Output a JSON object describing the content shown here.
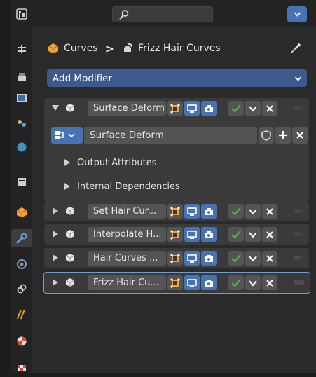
{
  "header": {
    "editor_type_icon": "properties-editor-icon",
    "search_placeholder": "",
    "dropdown_icon": "chevron-down-icon"
  },
  "breadcrumb": {
    "object_name": "Curves",
    "separator": ">",
    "data_name": "Frizz Hair Curves",
    "pin_icon": "pin-icon"
  },
  "add_modifier": {
    "label": "Add Modifier"
  },
  "modifiers": [
    {
      "name": "Surface Deform",
      "expanded": true
    },
    {
      "name": "Set Hair Cur...",
      "expanded": false
    },
    {
      "name": "Interpolate H...",
      "expanded": false
    },
    {
      "name": "Hair Curves ...",
      "expanded": false
    },
    {
      "name": "Frizz Hair Cu...",
      "expanded": false,
      "active": true
    }
  ],
  "surface_deform_panel": {
    "node_group_name": "Surface Deform",
    "subpanels": [
      "Output Attributes",
      "Internal Dependencies"
    ]
  },
  "sidebar_tabs": [
    "tool",
    "render",
    "output",
    "view-layer",
    "scene",
    "world",
    "collection",
    "object",
    "modifiers",
    "particles",
    "physics",
    "constraints",
    "data",
    "material",
    "texture"
  ],
  "colors": {
    "accent": "#4772b3",
    "check": "#59b14a",
    "panel": "#3a3a3a",
    "background": "#2a2a2a"
  }
}
